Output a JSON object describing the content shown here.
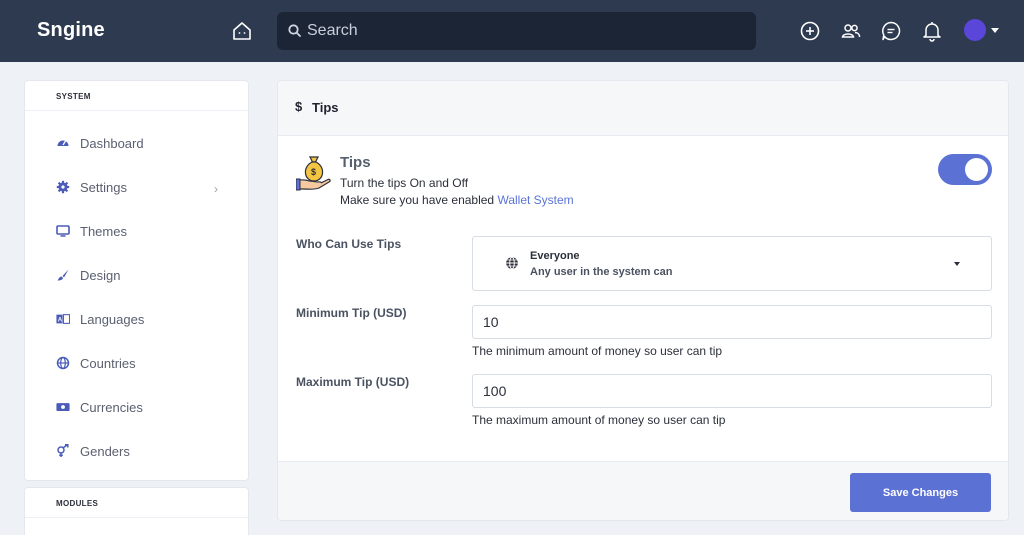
{
  "app": {
    "brand": "Sngine"
  },
  "topbar": {
    "search_placeholder": "Search",
    "icons": [
      "home-icon",
      "search-icon",
      "add-icon",
      "people-icon",
      "chat-icon",
      "bell-icon",
      "avatar",
      "caret-down-icon"
    ],
    "colors": {
      "background": "#2e3a50",
      "search_bg": "#1c2536"
    }
  },
  "sidebar": {
    "system_heading": "SYSTEM",
    "items": [
      {
        "label": "Dashboard",
        "icon": "dashboard-icon"
      },
      {
        "label": "Settings",
        "icon": "gear-icon",
        "has_chevron": true
      },
      {
        "label": "Themes",
        "icon": "monitor-icon"
      },
      {
        "label": "Design",
        "icon": "brush-icon"
      },
      {
        "label": "Languages",
        "icon": "language-icon"
      },
      {
        "label": "Countries",
        "icon": "globe-icon"
      },
      {
        "label": "Currencies",
        "icon": "money-icon"
      },
      {
        "label": "Genders",
        "icon": "gender-icon"
      }
    ],
    "chevron": "›",
    "modules_heading": "MODULES"
  },
  "main": {
    "header": {
      "icon": "$",
      "title": "Tips"
    },
    "feature": {
      "title": "Tips",
      "desc1": "Turn the tips On and Off",
      "desc2_prefix": "Make sure you have enabled ",
      "desc2_link": "Wallet System",
      "enabled": true
    },
    "who_can": {
      "label": "Who Can Use Tips",
      "selected_title": "Everyone",
      "selected_sub": "Any user in the system can"
    },
    "min_tip": {
      "label": "Minimum Tip (USD)",
      "value": "10",
      "help": "The minimum amount of money so user can tip"
    },
    "max_tip": {
      "label": "Maximum Tip (USD)",
      "value": "100",
      "help": "The maximum amount of money so user can tip"
    },
    "save_label": "Save Changes"
  },
  "colors": {
    "accent": "#5c71d4",
    "link": "#5a74d8",
    "page_bg": "#eef1f6"
  }
}
